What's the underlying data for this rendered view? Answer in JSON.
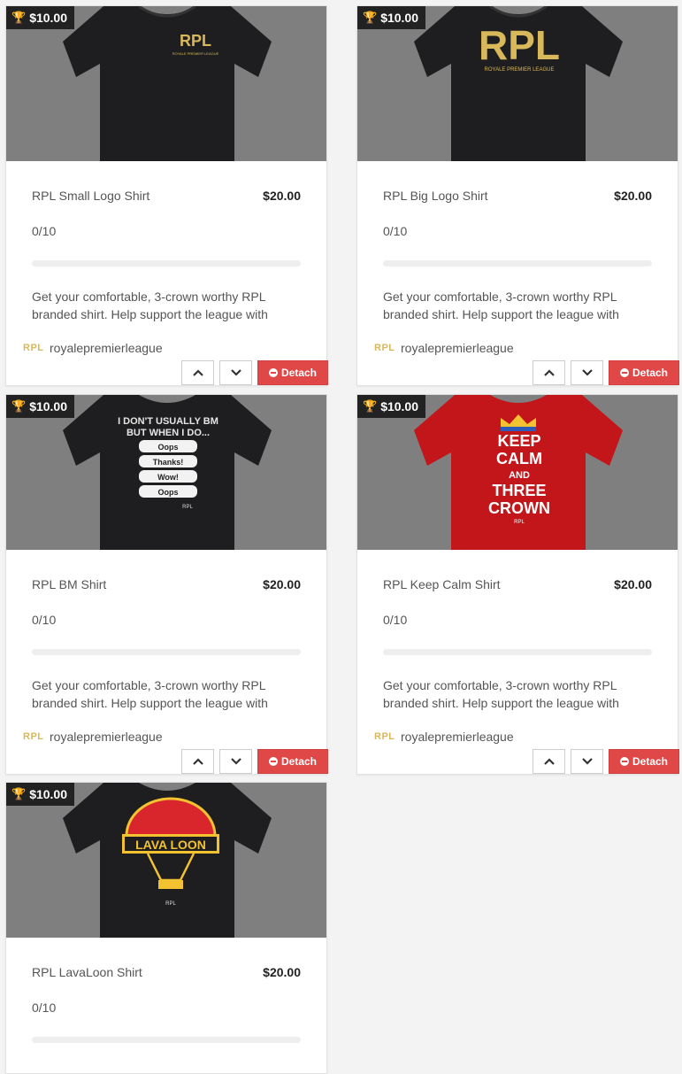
{
  "currency_bounty": "$10.00",
  "colors": {
    "background": "#f3f3f3",
    "image_bg": "#7f7f7f",
    "detach": "#e04848",
    "bounty_badge": "#222222",
    "trophy": "#f4c20d"
  },
  "cards": [
    {
      "title": "RPL Small Logo Shirt",
      "price": "$20.00",
      "bounty": "$10.00",
      "progress": "0/10",
      "progress_fraction": 0,
      "description": "Get your comfortable, 3-crown worthy RPL branded shirt. Help support the league with",
      "owner": "royalepremierleague",
      "owner_logo": "RPL",
      "up_icon": "chevron-up-icon",
      "down_icon": "chevron-down-icon",
      "detach_label": "Detach",
      "shirt_color": "#1e1e20",
      "shirt_text": [
        "RPL"
      ],
      "shirt_subtext": "ROYALE PREMIER LEAGUE"
    },
    {
      "title": "RPL Big Logo Shirt",
      "price": "$20.00",
      "bounty": "$10.00",
      "progress": "0/10",
      "progress_fraction": 0,
      "description": "Get your comfortable, 3-crown worthy RPL branded shirt. Help support the league with",
      "owner": "royalepremierleague",
      "owner_logo": "RPL",
      "up_icon": "chevron-up-icon",
      "down_icon": "chevron-down-icon",
      "detach_label": "Detach",
      "shirt_color": "#1e1e20",
      "shirt_text": [
        "RPL"
      ],
      "shirt_subtext": "ROYALE PREMIER LEAGUE"
    },
    {
      "title": "RPL BM Shirt",
      "price": "$20.00",
      "bounty": "$10.00",
      "progress": "0/10",
      "progress_fraction": 0,
      "description": "Get your comfortable, 3-crown worthy RPL branded shirt. Help support the league with",
      "owner": "royalepremierleague",
      "owner_logo": "RPL",
      "up_icon": "chevron-up-icon",
      "down_icon": "chevron-down-icon",
      "detach_label": "Detach",
      "shirt_color": "#1e1e20",
      "shirt_text": [
        "I DON'T USUALLY BM",
        "BUT WHEN I DO..."
      ],
      "bubbles": [
        "Oops",
        "Thanks!",
        "Wow!",
        "Oops"
      ],
      "shirt_subtext": "RPL"
    },
    {
      "title": "RPL Keep Calm Shirt",
      "price": "$20.00",
      "bounty": "$10.00",
      "progress": "0/10",
      "progress_fraction": 0,
      "description": "Get your comfortable, 3-crown worthy RPL branded shirt. Help support the league with",
      "owner": "royalepremierleague",
      "owner_logo": "RPL",
      "up_icon": "chevron-up-icon",
      "down_icon": "chevron-down-icon",
      "detach_label": "Detach",
      "shirt_color": "#c3161b",
      "shirt_text": [
        "KEEP",
        "CALM",
        "AND",
        "THREE",
        "CROWN"
      ],
      "shirt_subtext": "RPL"
    },
    {
      "title": "RPL LavaLoon Shirt",
      "price": "$20.00",
      "bounty": "$10.00",
      "progress": "0/10",
      "progress_fraction": 0,
      "description": "",
      "owner": "",
      "owner_logo": "",
      "up_icon": "chevron-up-icon",
      "down_icon": "chevron-down-icon",
      "detach_label": "",
      "shirt_color": "#1e1e20",
      "shirt_text": [
        "LAVA LOON"
      ],
      "shirt_subtext": "RPL"
    }
  ]
}
